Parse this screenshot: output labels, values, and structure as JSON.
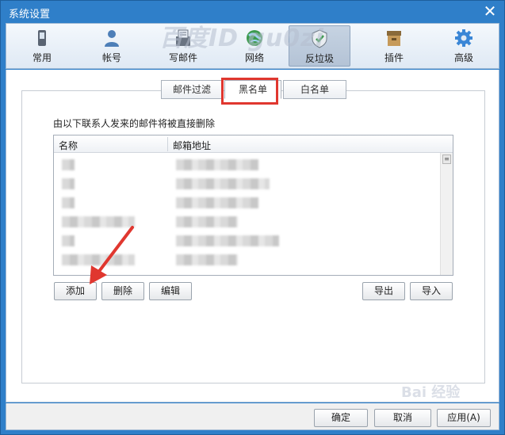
{
  "window": {
    "title": "系统设置",
    "close_symbol": "✕"
  },
  "toolbar": {
    "items": [
      {
        "label": "常用",
        "icon": "phone-icon"
      },
      {
        "label": "帐号",
        "icon": "user-icon"
      },
      {
        "label": "写邮件",
        "icon": "compose-icon"
      },
      {
        "label": "网络",
        "icon": "globe-icon"
      },
      {
        "label": "反垃圾",
        "icon": "shield-icon",
        "active": true
      },
      {
        "label": "插件",
        "icon": "plugin-box-icon"
      },
      {
        "label": "高级",
        "icon": "gear-icon"
      }
    ]
  },
  "watermark": {
    "text": "百度ID gu0zi"
  },
  "subtabs": [
    {
      "label": "邮件过滤"
    },
    {
      "label": "黑名单",
      "active": true
    },
    {
      "label": "白名单"
    }
  ],
  "description": "由以下联系人发来的邮件将被直接删除",
  "list": {
    "columns": [
      "名称",
      "邮箱地址"
    ],
    "row_count": 6
  },
  "list_buttons": {
    "add": "添加",
    "delete": "删除",
    "edit": "编辑",
    "export": "导出",
    "import": "导入"
  },
  "dialog_buttons": {
    "ok": "确定",
    "cancel": "取消",
    "apply": "应用(A)"
  },
  "colors": {
    "frame": "#2f7fc9",
    "highlight": "#e0372f"
  }
}
